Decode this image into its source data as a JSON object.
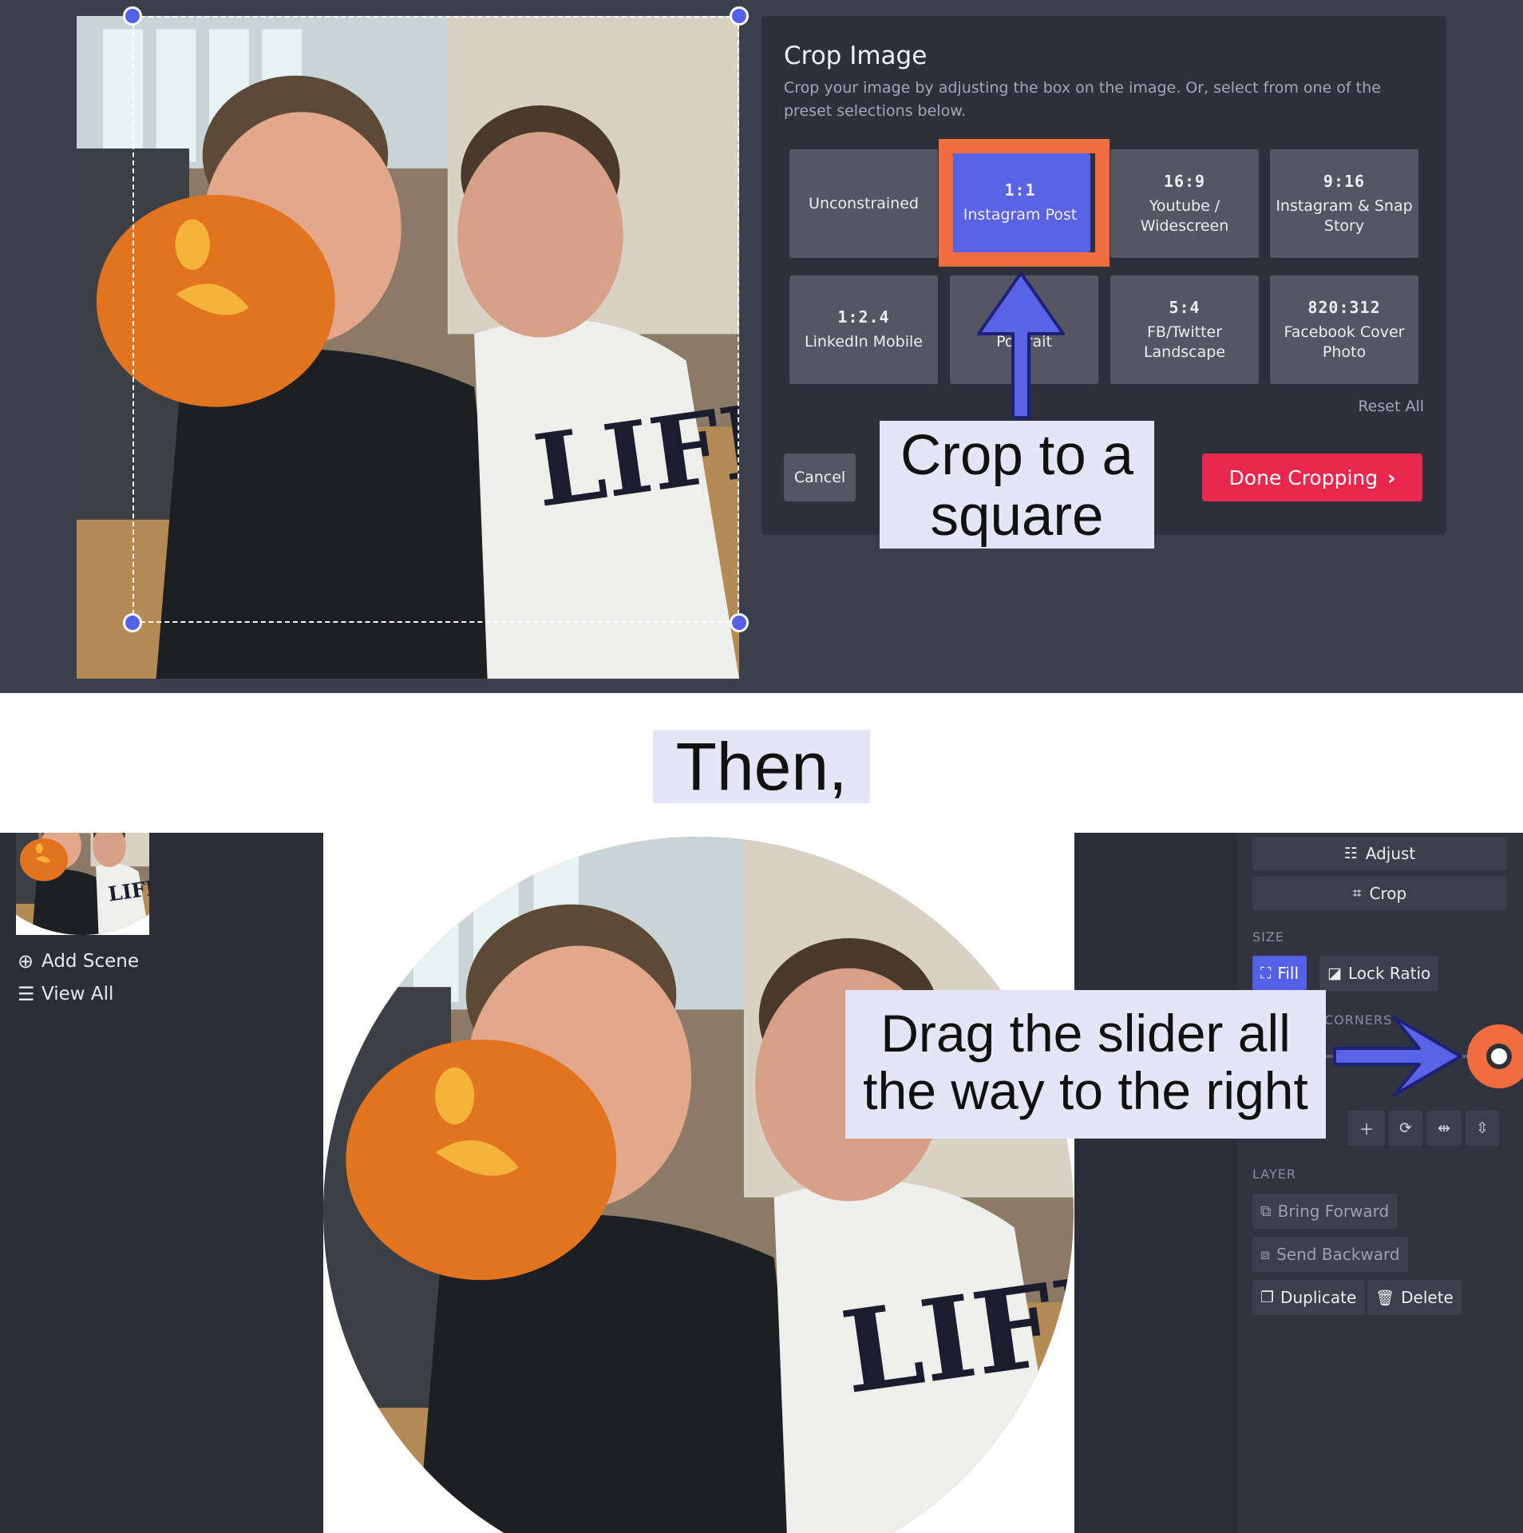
{
  "crop_dialog": {
    "title": "Crop Image",
    "description": "Crop your image by adjusting the box on the image. Or, select from one of the preset selections below.",
    "presets": [
      {
        "ratio": "",
        "label": "Unconstrained"
      },
      {
        "ratio": "1:1",
        "label": "Instagram Post"
      },
      {
        "ratio": "16:9",
        "label": "Youtube / Widescreen"
      },
      {
        "ratio": "9:16",
        "label": "Instagram & Snap Story"
      },
      {
        "ratio": "1:2.4",
        "label": "LinkedIn Mobile"
      },
      {
        "ratio": "",
        "label": "Portrait"
      },
      {
        "ratio": "5:4",
        "label": "FB/Twitter Landscape"
      },
      {
        "ratio": "820:312",
        "label": "Facebook Cover Photo"
      }
    ],
    "selected_preset": "1:1",
    "reset_label": "Reset All",
    "cancel_label": "Cancel",
    "done_label": "Done Cropping",
    "done_chevron": "›"
  },
  "callouts": {
    "crop_square": "Crop to a square",
    "then": "Then,",
    "drag_slider": "Drag the slider all the way to the right"
  },
  "scenes": {
    "add_scene": "Add Scene",
    "view_all": "View All"
  },
  "properties": {
    "adjust_label": "Adjust",
    "crop_label": "Crop",
    "size_label": "SIZE",
    "fill_label": "Fill",
    "lock_ratio_label": "Lock Ratio",
    "corners_label": "CORNERS",
    "layer_label": "LAYER",
    "bring_forward_label": "Bring Forward",
    "send_backward_label": "Send Backward",
    "duplicate_label": "Duplicate",
    "delete_label": "Delete",
    "corner_radius_slider_value": 1.0
  },
  "colors": {
    "accent_blue": "#5560e8",
    "highlight_orange": "#f26d3d",
    "done_red": "#e8294e",
    "panel_dark": "#2b2e39"
  },
  "icons": {
    "adjust": "sliders-icon",
    "crop": "crop-icon",
    "fill": "expand-icon",
    "lock_ratio": "aspect-ratio-icon",
    "bring_forward": "layer-up-icon",
    "send_backward": "layer-down-icon",
    "duplicate": "copy-icon",
    "delete": "trash-icon",
    "add_scene": "plus-circle-icon",
    "view_all": "list-icon"
  }
}
